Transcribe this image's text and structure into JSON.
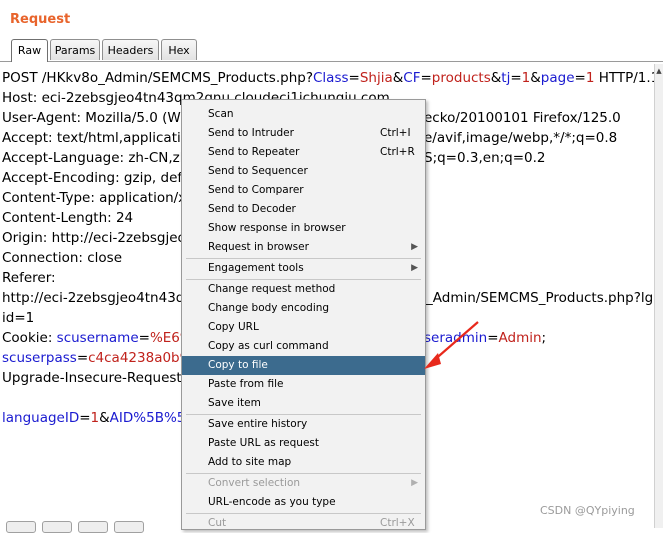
{
  "panel": {
    "title": "Request"
  },
  "tabs": [
    {
      "label": "Raw"
    },
    {
      "label": "Params"
    },
    {
      "label": "Headers"
    },
    {
      "label": "Hex"
    }
  ],
  "request": {
    "line1": {
      "prefix": "POST /HKkv8o_Admin/SEMCMS_Products.php?",
      "params": [
        {
          "key": "Class",
          "value": "Shjia"
        },
        {
          "key": "CF",
          "value": "products"
        },
        {
          "key": "tj",
          "value": "1"
        },
        {
          "key": "page",
          "value": "1"
        }
      ],
      "suffix": " HTTP/1.1"
    },
    "host": "Host: eci-2zebsgjeo4tn43qm2gnu.cloudeci1ichunqiu.com",
    "user_agent_left": "User-Agent: Mozilla/5.0 (Win",
    "user_agent_right": "ecko/20100101 Firefox/125.0",
    "accept_left": "Accept: text/html,application/",
    "accept_right": "e/avif,image/webp,*/*;q=0.8",
    "accept_language_left": "Accept-Language: zh-CN,zh;",
    "accept_language_right": "S;q=0.3,en;q=0.2",
    "accept_encoding_left": "Accept-Encoding: gzip, defla",
    "content_type_left": "Content-Type: application/x-",
    "content_length": "Content-Length: 24",
    "origin_left": "Origin: http://eci-2zebsgjeo4",
    "connection": "Connection: close",
    "referer": "Referer:",
    "referer_url_left": "http://eci-2zebsgjeo4tn43qm",
    "referer_url_right": "_Admin/SEMCMS_Products.php?lg",
    "referer_url_cont": "id=1",
    "cookie_label": "Cookie: ",
    "cookie_key1": "scusername",
    "cookie_val1_left": "%E6%",
    "cookie_key2_right": "seradmin",
    "cookie_val2": "Admin",
    "cookie_key3": "scuserpass",
    "cookie_val3_left": "c4ca4238a0b92",
    "upgrade_left": "Upgrade-Insecure-Requests:",
    "body_key1": "languageID",
    "body_val1": "1",
    "body_key2_left": "AID%5B%5D"
  },
  "context_menu": {
    "groups": [
      [
        {
          "label": "Scan"
        },
        {
          "label": "Send to Intruder",
          "shortcut": "Ctrl+I"
        },
        {
          "label": "Send to Repeater",
          "shortcut": "Ctrl+R"
        },
        {
          "label": "Send to Sequencer"
        },
        {
          "label": "Send to Comparer"
        },
        {
          "label": "Send to Decoder"
        },
        {
          "label": "Show response in browser"
        },
        {
          "label": "Request in browser",
          "submenu": true
        }
      ],
      [
        {
          "label": "Engagement tools",
          "submenu": true
        }
      ],
      [
        {
          "label": "Change request method"
        },
        {
          "label": "Change body encoding"
        },
        {
          "label": "Copy URL"
        },
        {
          "label": "Copy as curl command"
        },
        {
          "label": "Copy to file",
          "highlighted": true
        },
        {
          "label": "Paste from file"
        },
        {
          "label": "Save item"
        }
      ],
      [
        {
          "label": "Save entire history"
        },
        {
          "label": "Paste URL as request"
        },
        {
          "label": "Add to site map"
        }
      ],
      [
        {
          "label": "Convert selection",
          "submenu": true,
          "disabled": true
        },
        {
          "label": "URL-encode as you type"
        }
      ],
      [
        {
          "label": "Cut",
          "shortcut": "Ctrl+X",
          "disabled": true
        }
      ]
    ]
  },
  "annotation": {
    "arrow_color": "#e8291c"
  },
  "watermark": "CSDN @QYpiying",
  "colors": {
    "accent": "#e8642c",
    "highlight": "#3c6b8e",
    "param_key": "#1a1ad0",
    "param_value": "#c0221c"
  }
}
